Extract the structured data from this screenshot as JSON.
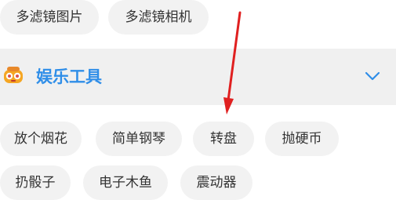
{
  "top_chips": [
    "多滤镜图片",
    "多滤镜相机"
  ],
  "section": {
    "title": "娱乐工具",
    "icon": "game-controller-icon",
    "chevron_icon": "chevron-down-icon",
    "accent_color": "#2f8ee8"
  },
  "row1": [
    "放个烟花",
    "简单钢琴",
    "转盘",
    "抛硬币"
  ],
  "row2": [
    "扔骰子",
    "电子木鱼",
    "震动器"
  ],
  "annotation": {
    "icon": "red-arrow-annotation",
    "color": "#e02020"
  }
}
